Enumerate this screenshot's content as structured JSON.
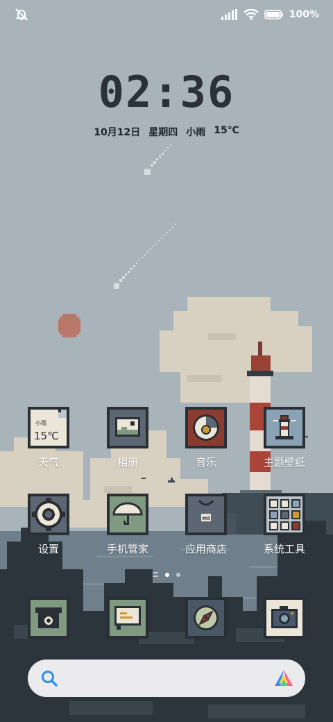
{
  "status_bar": {
    "left_icon": "bell-off-icon",
    "signal_icon": "cell-signal-icon",
    "wifi_icon": "wifi-icon",
    "battery_icon": "battery-icon",
    "battery_text": "100%"
  },
  "lockscreen": {
    "time": "02:36",
    "date": "10月12日",
    "weekday": "星期四",
    "weather": "小雨",
    "temperature": "15℃"
  },
  "apps_row1": [
    {
      "label": "天气",
      "icon": "weather-icon",
      "widget_small": "小雨",
      "widget_temp": "15℃"
    },
    {
      "label": "相册",
      "icon": "gallery-icon"
    },
    {
      "label": "音乐",
      "icon": "music-icon"
    },
    {
      "label": "主题壁纸",
      "icon": "themes-icon"
    }
  ],
  "apps_row2": [
    {
      "label": "设置",
      "icon": "settings-icon"
    },
    {
      "label": "手机管家",
      "icon": "security-icon"
    },
    {
      "label": "应用商店",
      "icon": "app-store-icon",
      "badge": "mi"
    },
    {
      "label": "系统工具",
      "icon": "system-tools-folder-icon"
    }
  ],
  "dock": [
    {
      "icon": "phone-icon"
    },
    {
      "icon": "messages-icon"
    },
    {
      "icon": "browser-icon"
    },
    {
      "icon": "camera-icon"
    }
  ],
  "pager": {
    "pages": 2,
    "active": 1
  },
  "search": {
    "placeholder": "",
    "left_icon": "search-icon",
    "right_icon": "assistant-icon"
  },
  "colors": {
    "sky": "#a9b4bb",
    "cloud": "#d9d1c3",
    "sea": "#6e7f8c",
    "tile_dark": "#2a2f35",
    "tile_gray": "#5c6773",
    "tile_green": "#7f9a80",
    "tile_red": "#8c3b30",
    "tile_cream": "#ece6d8"
  }
}
